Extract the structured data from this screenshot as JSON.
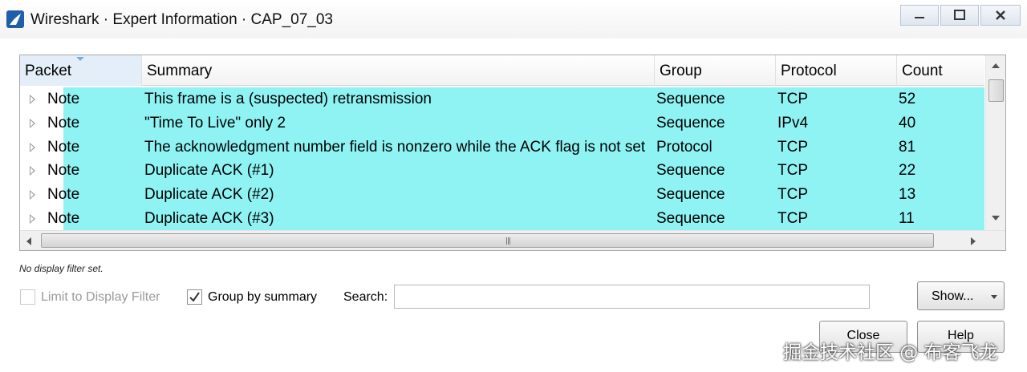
{
  "window": {
    "title": "Wireshark · Expert Information · CAP_07_03"
  },
  "table": {
    "columns": [
      "Packet",
      "Summary",
      "Group",
      "Protocol",
      "Count"
    ],
    "rows": [
      {
        "packet": "Note",
        "summary": "This frame is a (suspected) retransmission",
        "group": "Sequence",
        "protocol": "TCP",
        "count": "52"
      },
      {
        "packet": "Note",
        "summary": "\"Time To Live\" only 2",
        "group": "Sequence",
        "protocol": "IPv4",
        "count": "40"
      },
      {
        "packet": "Note",
        "summary": "The acknowledgment number field is nonzero while the ACK flag is not set",
        "group": "Protocol",
        "protocol": "TCP",
        "count": "81"
      },
      {
        "packet": "Note",
        "summary": "Duplicate ACK (#1)",
        "group": "Sequence",
        "protocol": "TCP",
        "count": "22"
      },
      {
        "packet": "Note",
        "summary": "Duplicate ACK (#2)",
        "group": "Sequence",
        "protocol": "TCP",
        "count": "13"
      },
      {
        "packet": "Note",
        "summary": "Duplicate ACK (#3)",
        "group": "Sequence",
        "protocol": "TCP",
        "count": "11"
      }
    ],
    "highlight_color": "#8ff3f3"
  },
  "status_text": "No display filter set.",
  "controls": {
    "limit_label": "Limit to Display Filter",
    "limit_checked": false,
    "group_label": "Group by summary",
    "group_checked": true,
    "search_label": "Search:",
    "search_value": "",
    "show_label": "Show...",
    "close_label": "Close",
    "help_label": "Help"
  },
  "watermark": "掘金技术社区 @ 布客飞龙",
  "icons": [
    "wireshark-fin-icon",
    "minimize-icon",
    "maximize-icon",
    "close-icon",
    "expand-arrow-icon",
    "checkmark-icon",
    "dropdown-caret-icon"
  ]
}
